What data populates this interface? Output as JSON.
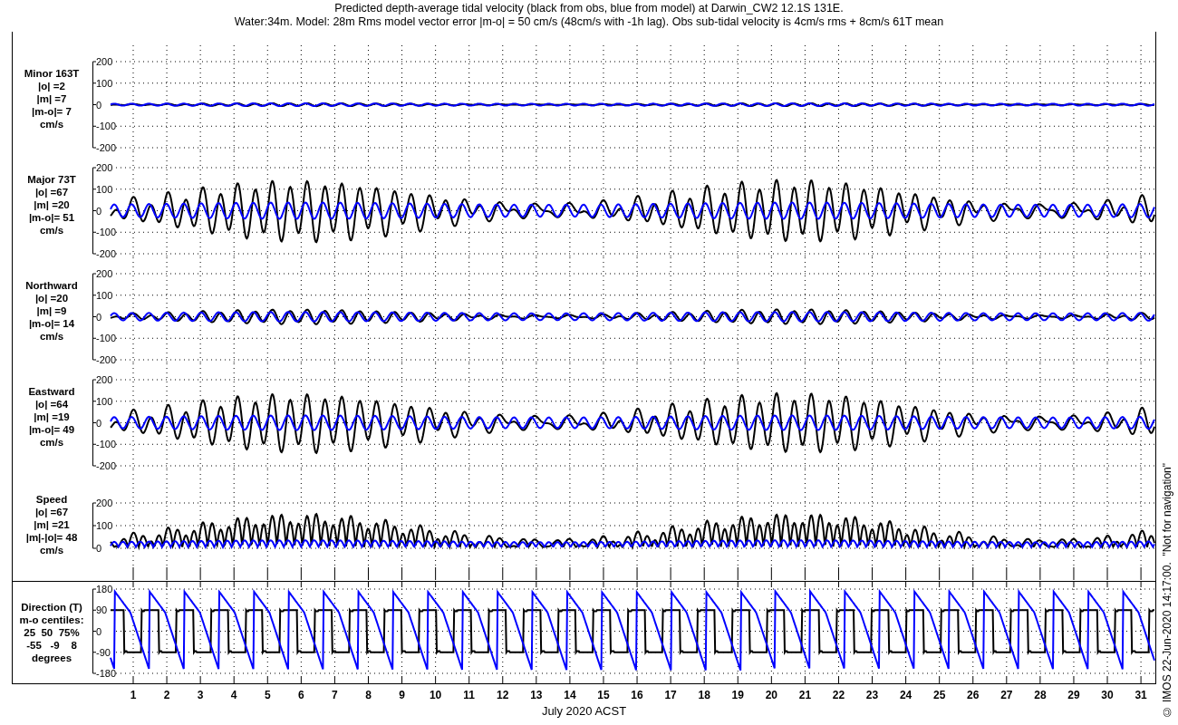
{
  "title_lines": [
    "Predicted depth-average tidal velocity (black from obs, blue from model) at Darwin_CW2 12.1S 131E.",
    "Water:34m. Model: 28m  Rms model vector error |m-o| = 50 cm/s (48cm/s with -1h lag). Obs sub-tidal velocity is 4cm/s rms + 8cm/s 61T mean"
  ],
  "panels": [
    {
      "kind": "vector",
      "label_lines": [
        "Minor 163T",
        "|o| =2",
        "|m| =7",
        "|m-o|= 7",
        "cm/s"
      ],
      "yticks": [
        "200",
        "100",
        "0",
        "-100",
        "-200"
      ]
    },
    {
      "kind": "vector",
      "label_lines": [
        "Major 73T",
        "|o| =67",
        "|m| =20",
        "|m-o|= 51",
        "cm/s"
      ],
      "yticks": [
        "200",
        "100",
        "0",
        "-100",
        "-200"
      ]
    },
    {
      "kind": "vector",
      "label_lines": [
        "Northward",
        "|o| =20",
        "|m| =9",
        "|m-o|= 14",
        "cm/s"
      ],
      "yticks": [
        "200",
        "100",
        "0",
        "-100",
        "-200"
      ]
    },
    {
      "kind": "vector",
      "label_lines": [
        "Eastward",
        "|o| =64",
        "|m| =19",
        "|m-o|= 49",
        "cm/s"
      ],
      "yticks": [
        "200",
        "100",
        "0",
        "-100",
        "-200"
      ]
    },
    {
      "kind": "speed",
      "label_lines": [
        "Speed",
        "|o| =67",
        "|m| =21",
        "|m|-|o|= 48",
        "cm/s"
      ],
      "yticks": [
        "200",
        "100",
        "0"
      ]
    },
    {
      "kind": "direction",
      "label_lines": [
        "Direction (T)",
        "m-o centiles:",
        "25  50  75%",
        "-55   -9    8",
        "degrees"
      ],
      "yticks": [
        "180",
        "90",
        "0",
        "-90",
        "-180"
      ]
    }
  ],
  "x_axis": {
    "days": [
      "1",
      "2",
      "3",
      "4",
      "5",
      "6",
      "7",
      "8",
      "9",
      "10",
      "11",
      "12",
      "13",
      "14",
      "15",
      "16",
      "17",
      "18",
      "19",
      "20",
      "21",
      "22",
      "23",
      "24",
      "25",
      "26",
      "27",
      "28",
      "29",
      "30",
      "31"
    ],
    "title": "July 2020 ACST"
  },
  "credit": "© IMOS 22-Jun-2020 14:17:00.  \"Not for navigation\""
}
